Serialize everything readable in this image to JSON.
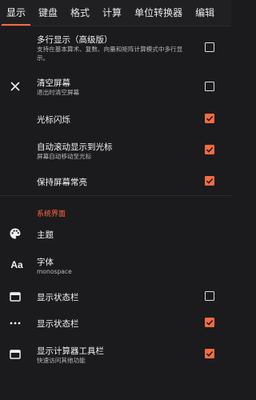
{
  "tabs": [
    {
      "label": "显示",
      "active": true
    },
    {
      "label": "键盘",
      "active": false
    },
    {
      "label": "格式",
      "active": false
    },
    {
      "label": "计算",
      "active": false
    },
    {
      "label": "单位转换器",
      "active": false
    },
    {
      "label": "编辑",
      "active": false
    }
  ],
  "settings": {
    "multiline": {
      "title": "多行显示（高级版）",
      "sub": "支持在基本算术、复数、向量和矩阵计算模式中多行显示。",
      "checked": false
    },
    "clear_screen": {
      "title": "清空屏幕",
      "sub": "退出时清空屏幕",
      "checked": false,
      "icon": "close-icon"
    },
    "cursor_blink": {
      "title": "光标闪烁",
      "checked": true
    },
    "auto_scroll": {
      "title": "自动滚动显示到光标",
      "sub": "屏幕自动移动至光标",
      "checked": true
    },
    "keep_screen_on": {
      "title": "保持屏幕常亮",
      "checked": true
    }
  },
  "system_section": {
    "title": "系统界面",
    "theme": {
      "title": "主题",
      "icon": "palette-icon"
    },
    "font": {
      "title": "字体",
      "sub": "monospace",
      "icon": "font-icon"
    },
    "status_bar_1": {
      "title": "显示状态栏",
      "checked": false,
      "icon": "window-icon"
    },
    "status_bar_2": {
      "title": "显示状态栏",
      "checked": true,
      "icon": "more-horizontal-icon"
    },
    "toolbar": {
      "title": "显示计算器工具栏",
      "sub": "快速访问其他功能",
      "checked": true,
      "icon": "window-icon"
    }
  },
  "colors": {
    "accent": "#ff6a3d",
    "background": "#1b1b1d"
  }
}
